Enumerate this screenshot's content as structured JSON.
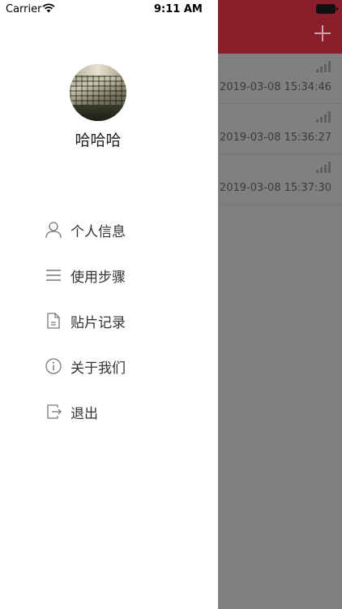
{
  "status_bar": {
    "carrier": "Carrier",
    "time": "9:11 AM"
  },
  "drawer": {
    "username": "哈哈哈",
    "menu": [
      {
        "label": "个人信息",
        "icon": "person-icon"
      },
      {
        "label": "使用步骤",
        "icon": "list-icon"
      },
      {
        "label": "贴片记录",
        "icon": "document-icon"
      },
      {
        "label": "关于我们",
        "icon": "info-icon"
      },
      {
        "label": "退出",
        "icon": "logout-icon"
      }
    ]
  },
  "background_list": {
    "header_color": "#8a1e2a",
    "rows": [
      {
        "time": "2019-03-08 15:34:46"
      },
      {
        "time": "2019-03-08 15:36:27"
      },
      {
        "time": "2019-03-08 15:37:30"
      }
    ]
  }
}
